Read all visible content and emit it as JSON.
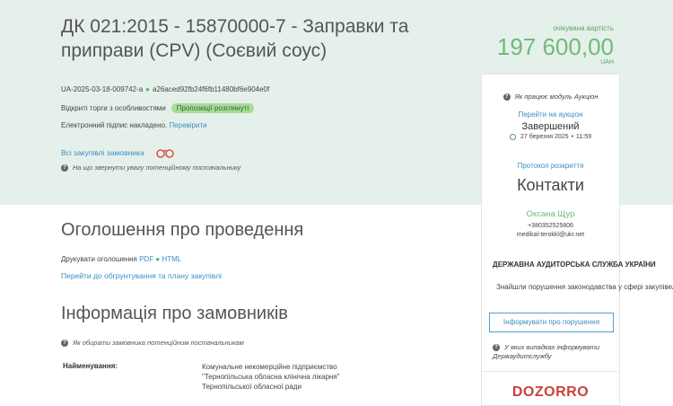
{
  "header": {
    "title": "ДК 021:2015 - 15870000-7 - Заправки та приправи (CPV) (Соєвий соус)",
    "tender_id": "UA-2025-03-18-009742-a",
    "separator": "●",
    "hash": "a26aced92fb24f6fb11480bf6e904e0f",
    "procedure_type": "Відкриті торги з особливостями",
    "status_badge": "Пропозиції розглянуті",
    "signature_text": "Електронний підпис накладено.",
    "signature_link": "Перевірити",
    "all_purchases_link": "Всі закупівлі замовника",
    "attention_hint": "На що звернути увагу потенційному постачальнику"
  },
  "value": {
    "label": "очікувана вартість",
    "amount": "197 600,00",
    "currency": "UAH"
  },
  "announcement": {
    "heading": "Оголошення про проведення",
    "print_label": "Друкувати оголошення",
    "pdf": "PDF",
    "dot": "●",
    "html": "HTML",
    "plan_link": "Перейти до обгрунтування та плану закупівлі"
  },
  "customer": {
    "heading": "Інформація про замовників",
    "hint": "Як обирати замовника потенційним постачальникам",
    "name_label": "Найменування:",
    "name_value": "Комунальне некомерційне підприємство \"Тернопільська обласна клінічна лікарня\" Тернопільської обласної ради"
  },
  "sidebar": {
    "auction_hint": "Як працює модуль Аукціон",
    "goto_auction": "Перейти на аукціон",
    "auction_status": "Завершений",
    "auction_date": "27 березня 2025",
    "auction_time": "11:59",
    "protocol_link": "Протокол розкриття",
    "contacts_heading": "Контакти",
    "contact_name": "Оксана Щур",
    "contact_phone": "+380352525806",
    "contact_email": "medikal-terokkl@ukr.net",
    "audit_heading": "ДЕРЖАВНА АУДИТОРСЬКА СЛУЖБА УКРАЇНИ",
    "audit_question": "Знайшли порушення законодавства у сфері закупівель?",
    "report_button": "Інформувати про порушення",
    "audit_hint": "У яких випадках інформувати Держаудитслужбу",
    "logo_text": "DOZORRO"
  },
  "colors": {
    "band": "#e6f0ea",
    "accent_green": "#6fba7a",
    "link_blue": "#3a8fc4",
    "logo_red": "#c8423a"
  }
}
